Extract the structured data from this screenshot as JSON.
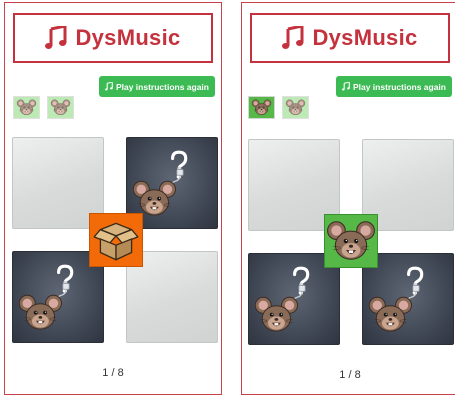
{
  "app": {
    "title": "DysMusic",
    "play_label": "Play instructions again"
  },
  "colors": {
    "brand": "#c4323d",
    "button": "#3cba54",
    "match_tile": "#56b947",
    "dropbox_tile": "#f26b08"
  },
  "icons": [
    "music-note-icon",
    "mouse-icon",
    "question-mark-icon",
    "dropbox-icon"
  ],
  "panels": [
    {
      "counter": "1 / 8",
      "progress": {
        "found": 0,
        "remaining": 2
      },
      "cards": [
        "blank",
        "hidden-mouse",
        "hidden-mouse",
        "blank"
      ],
      "dragged_tile": "dropbox"
    },
    {
      "counter": "1 / 8",
      "progress": {
        "found": 1,
        "remaining": 1
      },
      "cards": [
        "blank",
        "blank",
        "hidden-mouse",
        "hidden-mouse"
      ],
      "dragged_tile": "mouse"
    }
  ]
}
